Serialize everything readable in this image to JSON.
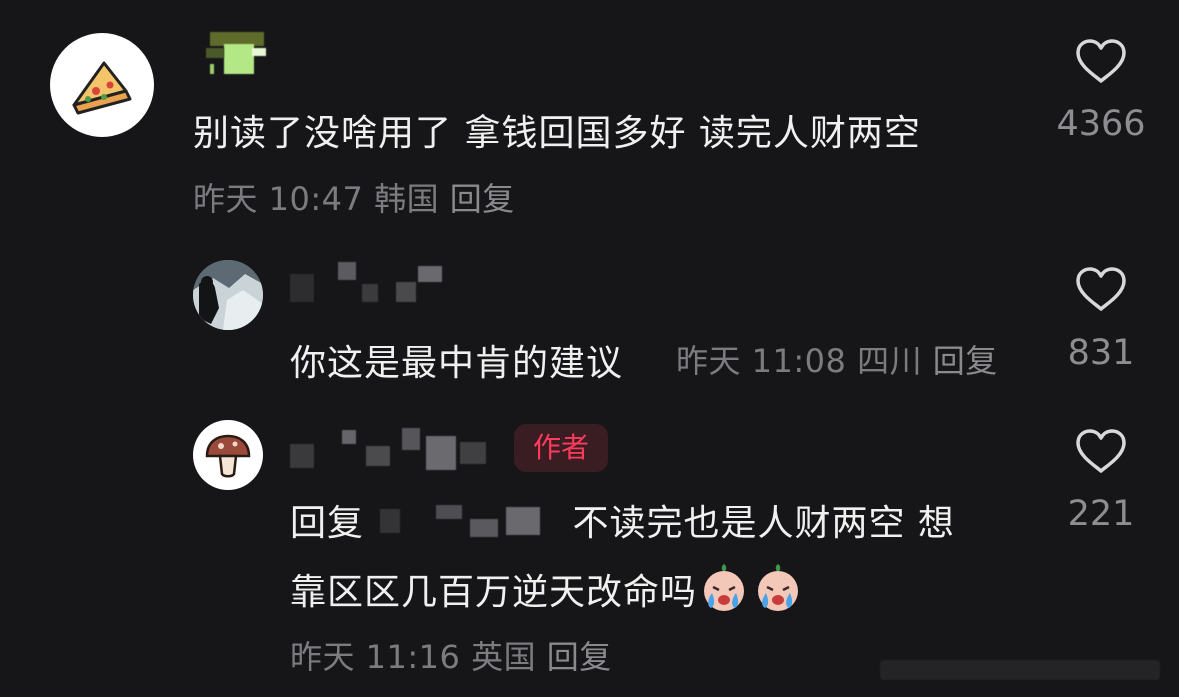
{
  "comments": [
    {
      "text": "别读了没啥用了 拿钱回国多好 读完人财两空",
      "time": "昨天 10:47",
      "location": "韩国",
      "reply_label": "回复",
      "likes": "4366",
      "avatar_icon": "pizza-icon"
    },
    {
      "text": "你这是最中肯的建议",
      "time": "昨天 11:08",
      "location": "四川",
      "reply_label": "回复",
      "likes": "831",
      "avatar_icon": "photo-avatar"
    },
    {
      "badge": "作者",
      "reply_prefix": "回复",
      "text_line1": "不读完也是人财两空 想",
      "text_line2": "靠区区几百万逆天改命吗",
      "emoji": "crying-face-emoji",
      "time": "昨天 11:16",
      "location": "英国",
      "reply_label": "回复",
      "likes": "221",
      "avatar_icon": "mushroom-icon"
    }
  ],
  "colors": {
    "background": "#161618",
    "text": "#f0f0f0",
    "meta": "#7c7c80",
    "badge_text": "#ff3b5c",
    "badge_bg": "#3a1d23"
  }
}
